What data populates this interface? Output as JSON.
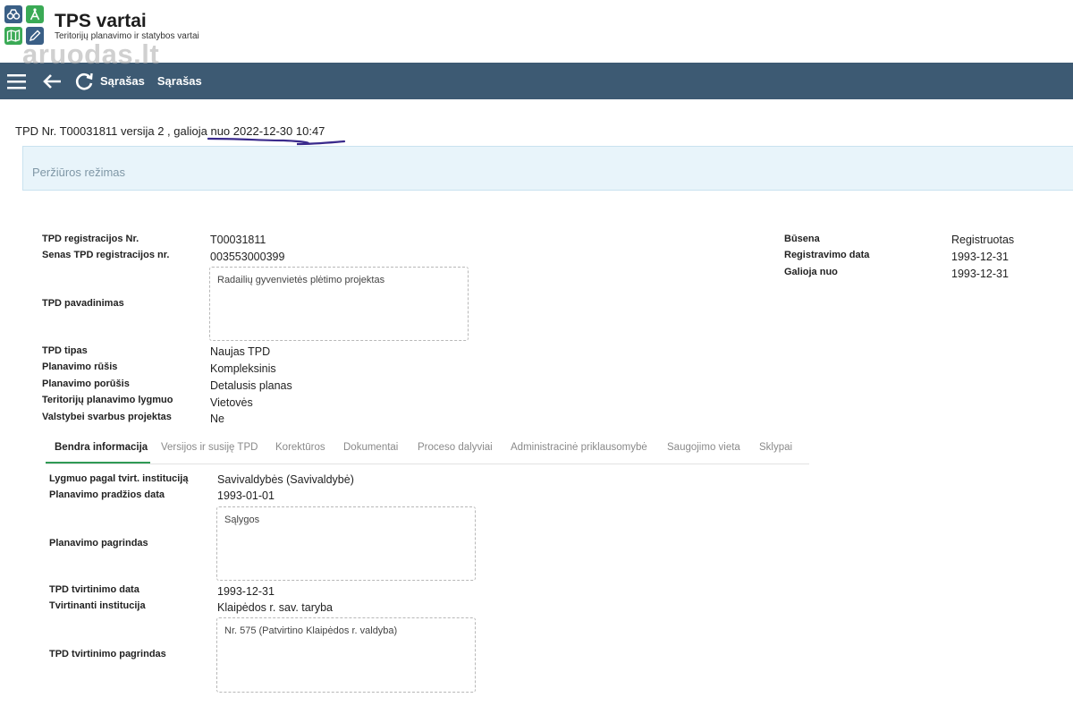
{
  "app": {
    "title": "TPS vartai",
    "subtitle": "Teritorijų planavimo ir statybos vartai",
    "watermark": "aruodas.lt"
  },
  "navbar": {
    "link1": "Sąrašas",
    "link2": "Sąrašas",
    "bg_color": "#3d5a73"
  },
  "record": {
    "title": "TPD Nr. T00031811 versija 2 , galioja nuo 2022-12-30 10:47",
    "mode": "Peržiūros režimas"
  },
  "fields": {
    "reg_nr_label": "TPD registracijos Nr.",
    "reg_nr_value": "T00031811",
    "old_reg_label": "Senas TPD registracijos nr.",
    "old_reg_value": "003553000399",
    "name_label": "TPD pavadinimas",
    "name_value": "Radailių gyvenvietės plėtimo projektas",
    "type_label": "TPD tipas",
    "type_value": "Naujas TPD",
    "kind_label": "Planavimo rūšis",
    "kind_value": "Kompleksinis",
    "subkind_label": "Planavimo porūšis",
    "subkind_value": "Detalusis planas",
    "level_label": "Teritorijų planavimo lygmuo",
    "level_value": "Vietovės",
    "state_label": "Valstybei svarbus projektas",
    "state_value": "Ne",
    "status_label": "Būsena",
    "status_value": "Registruotas",
    "regdate_label": "Registravimo data",
    "regdate_value": "1993-12-31",
    "valid_label": "Galioja nuo",
    "valid_value": "1993-12-31"
  },
  "tabs": [
    "Bendra informacija",
    "Versijos ir susiję TPD",
    "Korektūros",
    "Dokumentai",
    "Proceso dalyviai",
    "Administracinė priklausomybė",
    "Saugojimo vieta",
    "Sklypai"
  ],
  "general": {
    "inst_label": "Lygmuo pagal tvirt. instituciją",
    "inst_value": "Savivaldybės (Savivaldybė)",
    "start_label": "Planavimo pradžios data",
    "start_value": "1993-01-01",
    "basis_label": "Planavimo pagrindas",
    "basis_value": "Sąlygos",
    "approve_date_label": "TPD tvirtinimo data",
    "approve_date_value": "1993-12-31",
    "approve_inst_label": "Tvirtinanti institucija",
    "approve_inst_value": "Klaipėdos r. sav. taryba",
    "approve_basis_label": "TPD tvirtinimo pagrindas",
    "approve_basis_value": "Nr. 575 (Patvirtino Klaipėdos r. valdyba)"
  }
}
